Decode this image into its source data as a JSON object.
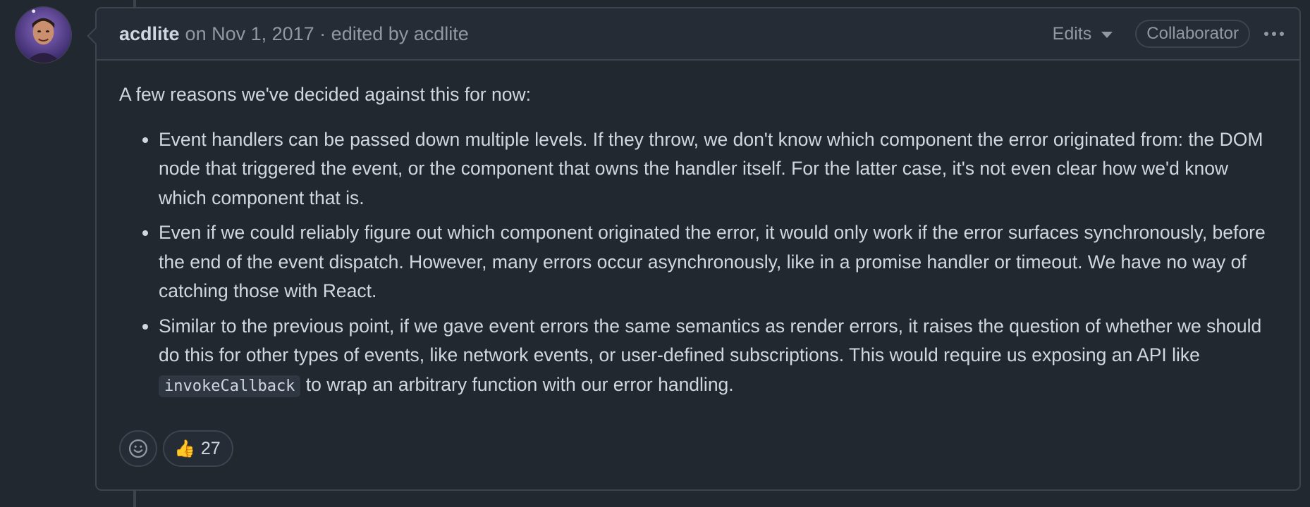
{
  "comment": {
    "author": "acdlite",
    "meta": "on Nov 1, 2017 · edited by acdlite",
    "edits_label": "Edits",
    "role_badge": "Collaborator",
    "intro": "A few reasons we've decided against this for now:",
    "bullets": [
      "Event handlers can be passed down multiple levels. If they throw, we don't know which component the error originated from: the DOM node that triggered the event, or the component that owns the handler itself. For the latter case, it's not even clear how we'd know which component that is.",
      "Even if we could reliably figure out which component originated the error, it would only work if the error surfaces synchronously, before the end of the event dispatch. However, many errors occur asynchronously, like in a promise handler or timeout. We have no way of catching those with React."
    ],
    "bullet3": {
      "before": "Similar to the previous point, if we gave event errors the same semantics as render errors, it raises the question of whether we should do this for other types of events, like network events, or user-defined subscriptions. This would require us exposing an API like ",
      "code": "invokeCallback",
      "after": " to wrap an arbitrary function with our error handling."
    }
  },
  "reactions": {
    "thumbs_up_emoji": "👍",
    "thumbs_up_count": "27"
  },
  "icons": {
    "add_reaction": "smiley-icon",
    "more": "kebab-horizontal-icon",
    "dropdown": "triangle-down-icon"
  },
  "colors": {
    "background": "#212830",
    "header": "#262c36",
    "border": "#3d444d",
    "muted_text": "#9198a1",
    "text": "#d1d7e0"
  }
}
